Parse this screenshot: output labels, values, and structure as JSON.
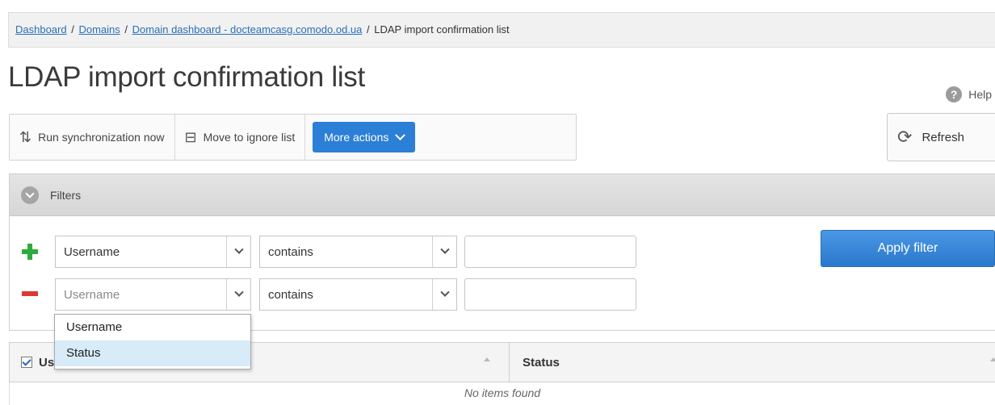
{
  "breadcrumb": {
    "items": [
      {
        "label": "Dashboard"
      },
      {
        "label": "Domains"
      },
      {
        "label": "Domain dashboard - docteamcasg.comodo.od.ua"
      }
    ],
    "current": "LDAP import confirmation list",
    "separator": "/"
  },
  "page": {
    "title": "LDAP import confirmation list",
    "help_label": "Help"
  },
  "toolbar": {
    "run_sync_label": "Run synchronization now",
    "move_ignore_label": "Move to ignore list",
    "more_actions_label": "More actions",
    "refresh_label": "Refresh"
  },
  "filters": {
    "title": "Filters",
    "rows": [
      {
        "field": "Username",
        "operator": "contains",
        "value": ""
      },
      {
        "field": "Username",
        "operator": "contains",
        "value": ""
      }
    ],
    "apply_label": "Apply filter",
    "dropdown_options": [
      "Username",
      "Status"
    ],
    "dropdown_highlighted": "Status"
  },
  "table": {
    "columns": [
      "Username",
      "Status"
    ],
    "empty_text": "No items found"
  },
  "colors": {
    "accent": "#2c7fd6",
    "link": "#2a6fb7",
    "add": "#2eab3f",
    "remove": "#d93a33"
  }
}
